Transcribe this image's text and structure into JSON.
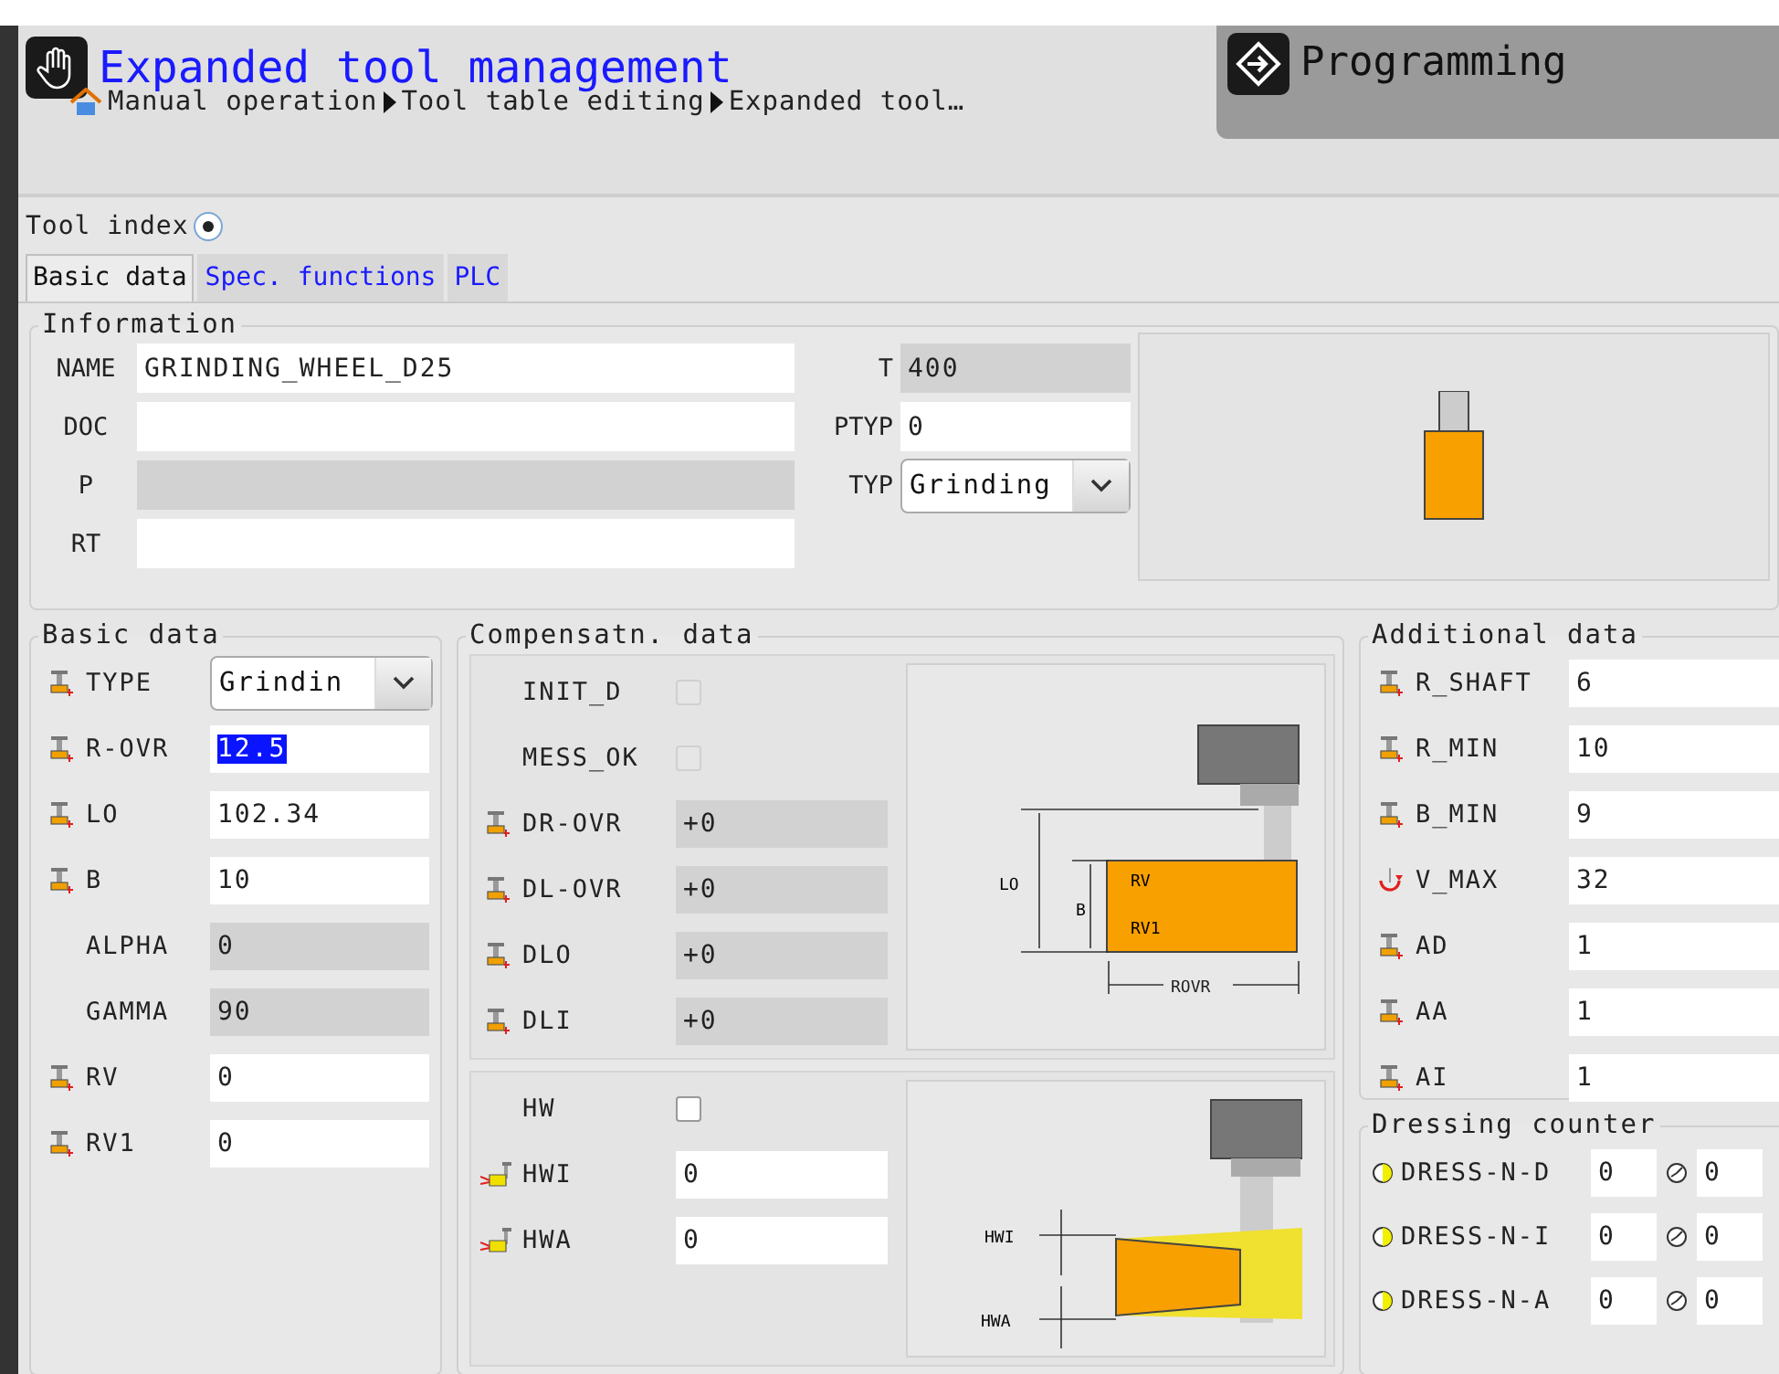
{
  "header": {
    "title": "Expanded tool management",
    "breadcrumb": [
      "Manual operation",
      "Tool table editing",
      "Expanded tool…"
    ],
    "mode": "Programming"
  },
  "tool_index": {
    "label": "Tool index",
    "checked": true
  },
  "tabs": [
    {
      "label": "Basic data",
      "selected": true
    },
    {
      "label": "Spec. functions",
      "selected": false
    },
    {
      "label": "PLC",
      "selected": false
    }
  ],
  "information": {
    "title": "Information",
    "left_fields": [
      {
        "label": "NAME",
        "value": "GRINDING_WHEEL_D25",
        "disabled": false
      },
      {
        "label": "DOC",
        "disabled": false
      },
      {
        "label": "P",
        "disabled": true
      },
      {
        "label": "RT",
        "disabled": false
      }
    ],
    "right_fields": [
      {
        "label": "T",
        "value": "400",
        "kind": "field",
        "disabled": true
      },
      {
        "label": "PTYP",
        "value": "0",
        "kind": "field",
        "disabled": false
      },
      {
        "label": "TYP",
        "value": "Grinding",
        "kind": "select",
        "disabled": false
      }
    ]
  },
  "basic_data": {
    "title": "Basic data",
    "fields": [
      {
        "label": "TYPE",
        "value": "Grindin",
        "kind": "select",
        "disabled": false
      },
      {
        "label": "R-OVR",
        "value": "12.5",
        "kind": "tool_field",
        "disabled": false,
        "highlighted": true
      },
      {
        "label": "LO",
        "value": "102.34",
        "kind": "tool_field",
        "disabled": false,
        "highlighted": false
      },
      {
        "label": "B",
        "value": "10",
        "kind": "tool_field",
        "disabled": false,
        "highlighted": false
      },
      {
        "label": "ALPHA",
        "value": "0",
        "kind": "field",
        "disabled": true,
        "highlighted": false
      },
      {
        "label": "GAMMA",
        "value": "90",
        "kind": "field",
        "disabled": true,
        "highlighted": false
      },
      {
        "label": "RV",
        "value": "0",
        "kind": "tool_field",
        "disabled": false,
        "highlighted": false
      },
      {
        "label": "RV1",
        "value": "0",
        "kind": "tool_field",
        "disabled": false,
        "highlighted": false
      }
    ]
  },
  "compensation": {
    "title": "Compensatn. data",
    "rows": [
      {
        "label": "INIT_D",
        "kind": "checkbox",
        "checked": false,
        "disabled": true
      },
      {
        "label": "MESS_OK",
        "kind": "checkbox",
        "checked": false,
        "disabled": true
      },
      {
        "label": "DR-OVR",
        "kind": "tool_field",
        "value": "+0",
        "disabled": true
      },
      {
        "label": "DL-OVR",
        "kind": "tool_field",
        "value": "+0",
        "disabled": true
      },
      {
        "label": "DLO",
        "kind": "tool_field",
        "value": "+0",
        "disabled": true
      },
      {
        "label": "DLI",
        "kind": "tool_field",
        "value": "+0",
        "disabled": true
      }
    ],
    "diagram_labels": [
      "LO",
      "B",
      "RV",
      "RV1",
      "ROVR"
    ],
    "wear_rows": [
      {
        "label": "HW",
        "kind": "checkbox",
        "checked": false,
        "disabled": false
      },
      {
        "label": "HWI",
        "kind": "wear_field",
        "value": "0",
        "disabled": false
      },
      {
        "label": "HWA",
        "kind": "wear_field",
        "value": "0",
        "disabled": false
      }
    ],
    "wear_diagram_labels": [
      "HWI",
      "HWA"
    ]
  },
  "additional_data": {
    "title": "Additional data",
    "fields": [
      {
        "label": "R_SHAFT",
        "value": "6",
        "kind": "tool_field"
      },
      {
        "label": "R_MIN",
        "value": "10",
        "kind": "tool_field"
      },
      {
        "label": "B_MIN",
        "value": "9",
        "kind": "tool_field"
      },
      {
        "label": "V_MAX",
        "value": "32",
        "kind": "speed_field"
      },
      {
        "label": "AD",
        "value": "1",
        "kind": "tool_field"
      },
      {
        "label": "AA",
        "value": "1",
        "kind": "tool_field"
      },
      {
        "label": "AI",
        "value": "1",
        "kind": "tool_field"
      }
    ]
  },
  "dressing_counter": {
    "title": "Dressing counter",
    "rows": [
      {
        "label": "DRESS-N-D",
        "value": "0",
        "value_2": "0"
      },
      {
        "label": "DRESS-N-I",
        "value": "0",
        "value_2": "0"
      },
      {
        "label": "DRESS-N-A",
        "value": "0",
        "value_2": "0"
      }
    ]
  }
}
